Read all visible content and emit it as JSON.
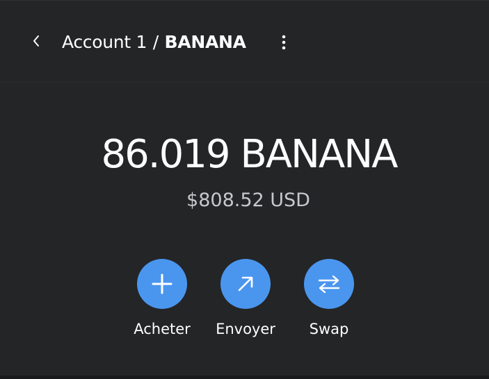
{
  "header": {
    "account": "Account 1",
    "separator": "/",
    "token": "BANANA",
    "back_icon": "chevron-left-icon",
    "menu_icon": "kebab-menu-icon"
  },
  "balance": {
    "amount": "86.019",
    "symbol": "BANANA",
    "fiat": "$808.52 USD"
  },
  "actions": [
    {
      "label": "Acheter",
      "icon": "plus-icon"
    },
    {
      "label": "Envoyer",
      "icon": "arrow-up-right-icon"
    },
    {
      "label": "Swap",
      "icon": "swap-arrows-icon"
    }
  ],
  "colors": {
    "background": "#242527",
    "accent": "#4a96ef",
    "text": "#ffffff",
    "muted_text": "#c6c8cc"
  }
}
